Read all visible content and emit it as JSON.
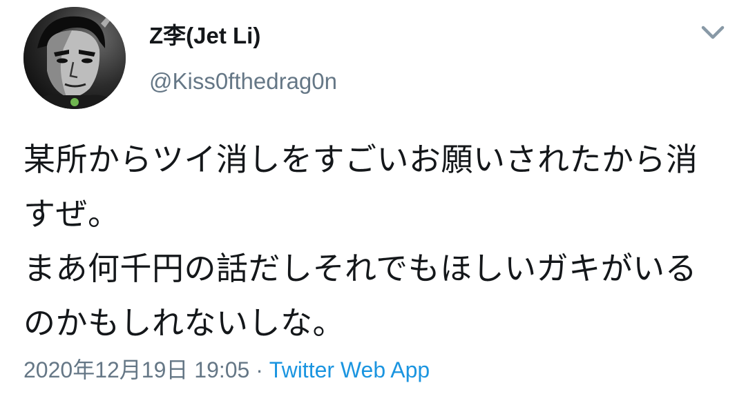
{
  "user": {
    "display_name": "Z李(Jet Li)",
    "handle": "@Kiss0fthedrag0n"
  },
  "tweet": {
    "text": "某所からツイ消しをすごいお願いされたから消すぜ。\nまあ何千円の話だしそれでもほしいガキがいるのかもしれないしな。",
    "timestamp": "2020年12月19日 19:05",
    "separator": " · ",
    "source": "Twitter Web App"
  },
  "icons": {
    "menu": "chevron-down-icon",
    "avatar": "profile-avatar"
  },
  "colors": {
    "text": "#14171a",
    "secondary": "#657786",
    "link": "#1b95e0"
  }
}
